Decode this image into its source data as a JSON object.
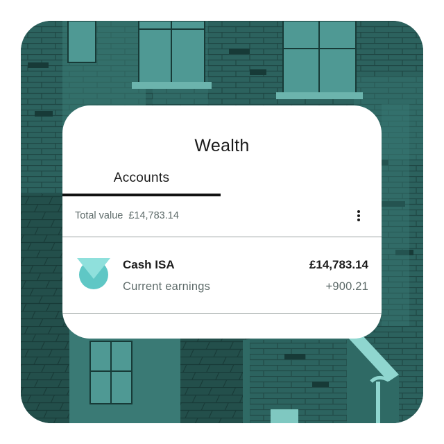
{
  "card": {
    "title": "Wealth",
    "tabs": [
      {
        "label": "Accounts",
        "active": true
      }
    ],
    "total_label": "Total value",
    "total_value": "£14,783.14",
    "more_icon": "more-vertical-icon"
  },
  "accounts": [
    {
      "name": "Cash ISA",
      "sub_label": "Current earnings",
      "amount": "£14,783.14",
      "earnings": "+900.21",
      "icon": "cash-isa-icon"
    }
  ],
  "colors": {
    "background_teal": "#2a5e5a",
    "accent_teal": "#5fc7c5",
    "accent_light": "#8fe0dc",
    "text_dark": "#1a1a1a",
    "text_muted": "#5e6b6a"
  }
}
